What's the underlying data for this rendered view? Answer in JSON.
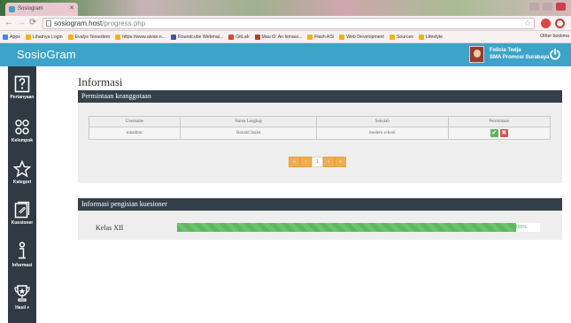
{
  "browser": {
    "tab_title": "Sosiogram",
    "url_host": "sosiogram.host",
    "url_path": "/progress.php",
    "bookmarks": [
      {
        "label": "Apps",
        "color": "#4285f4"
      },
      {
        "label": "Lihatnya Login",
        "color": "#f4b400"
      },
      {
        "label": "Evalys Tersedent",
        "color": "#f4b400"
      },
      {
        "label": "https://www.alvan.n...",
        "color": "#f4b400"
      },
      {
        "label": "Roundcube Webmai...",
        "color": "#3b5998"
      },
      {
        "label": "GitLab",
        "color": "#e24329"
      },
      {
        "label": "Mau O: An Ismaui...",
        "color": "#c0392b"
      },
      {
        "label": "Flash ASI",
        "color": "#f4b400"
      },
      {
        "label": "Web Development",
        "color": "#f4b400"
      },
      {
        "label": "Sources",
        "color": "#f4b400"
      },
      {
        "label": "Lifestyle",
        "color": "#f4b400"
      }
    ],
    "other_bookmarks": "Other bookma"
  },
  "app": {
    "brand": "SosioGram",
    "accent": "#3da3c8",
    "user": {
      "name": "Felicia Tedja",
      "school": "SMA Promosi Surabaya"
    }
  },
  "sidebar": {
    "items": [
      {
        "label": "Pertanyaan",
        "icon": "question-icon"
      },
      {
        "label": "Kelompok",
        "icon": "group-icon"
      },
      {
        "label": "Kategori",
        "icon": "star-icon"
      },
      {
        "label": "Kuesioner",
        "icon": "document-icon"
      },
      {
        "label": "Informasi",
        "icon": "info-icon",
        "active": true
      },
      {
        "label": "Hasil ▾",
        "icon": "trophy-icon"
      }
    ]
  },
  "main": {
    "title": "Informasi",
    "membership_panel": {
      "title": "Permintaan keanggotaan",
      "columns": [
        "Username",
        "Nama Lengkap",
        "Sekolah",
        "Permintaan"
      ],
      "rows": [
        {
          "username": "tonaldrac",
          "full_name": "Ronald Jaqist",
          "school": "modern school"
        }
      ]
    },
    "pagination": [
      "«",
      "‹",
      "1",
      "›",
      "»"
    ],
    "questionnaire_panel": {
      "title": "Informasi pengisian kuesioner",
      "rows": [
        {
          "label": "Kelas XII",
          "progress_percent": 100,
          "progress_text": "100%"
        }
      ]
    }
  }
}
